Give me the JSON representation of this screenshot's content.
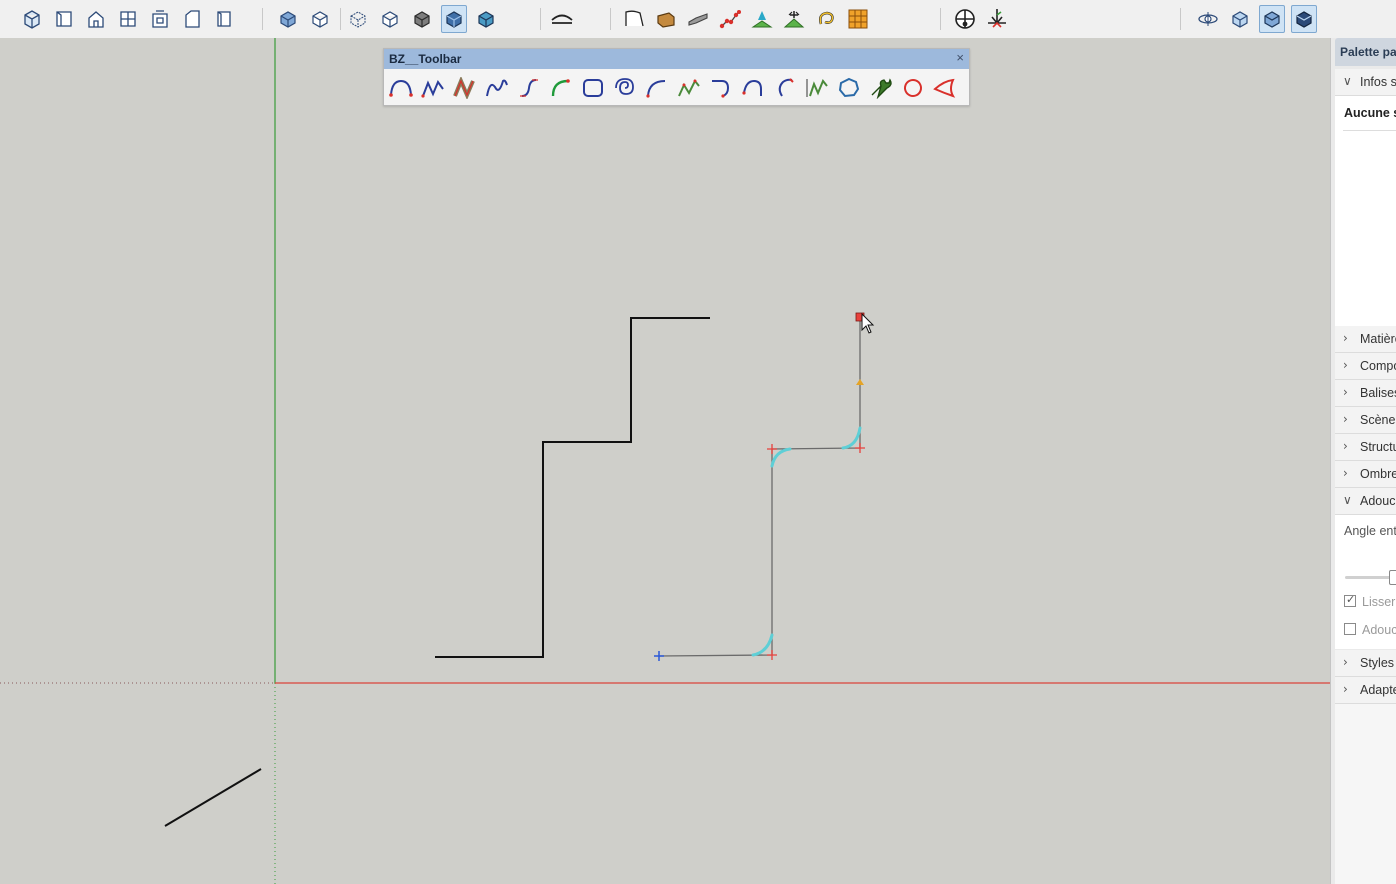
{
  "main_toolbar": {
    "icons": [
      "iso-view-icon",
      "top-view-icon",
      "front-view-icon",
      "right-view-icon",
      "back-view-icon",
      "left-view-icon",
      "bottom-view-icon",
      "xray-style-icon",
      "back-edges-style-icon",
      "wireframe-style-icon",
      "hidden-line-style-icon",
      "shaded-style-icon",
      "shaded-textures-style-icon",
      "monochrome-style-icon",
      "section-plane-icon",
      "sandbox-from-contours-icon",
      "sandbox-from-scratch-icon",
      "smoove-icon",
      "stamp-icon",
      "drape-icon",
      "add-detail-icon",
      "flip-edge-icon",
      "grid-icon",
      "axes-tool-icon",
      "dimension-tool-icon",
      "orbit-icon",
      "component-options-icon",
      "component-attributes-icon",
      "generate-report-icon"
    ]
  },
  "bz_toolbar": {
    "title": "BZ__Toolbar",
    "close_label": "×",
    "tools": [
      "bezier-classic-icon",
      "polyline-icon",
      "spline-icon",
      "b-spline-icon",
      "cubic-bezier-icon",
      "fillet-arc-icon",
      "rounded-rectangle-icon",
      "spiral-icon",
      "arc-icon",
      "uniform-bspline-icon",
      "catmull-spline-icon",
      "curve-continue-icon",
      "freehand-curve-icon",
      "polyline-divider-icon",
      "polygon-icon",
      "settings-wrench-icon",
      "ellipse-icon",
      "triangle-icon"
    ]
  },
  "panel": {
    "title": "Palette par défaut",
    "entity_info": {
      "label": "Infos sur l'entité",
      "value": "Aucune sélection"
    },
    "sections": [
      "Matières",
      "Composants",
      "Balises",
      "Scènes",
      "Structure",
      "Ombres"
    ],
    "smooth": {
      "label": "Adoucir les arêtes",
      "angle_label": "Angle entre les normales",
      "lisser_label": "Lisser les normales",
      "lisser_checked": true,
      "adoucir_label": "Adoucir les coplanaires",
      "adoucir_checked": false
    },
    "sections_after": [
      "Styles",
      "Adapter la photo"
    ]
  },
  "colors": {
    "x_axis": "#d9453a",
    "y_axis": "#3a9d3a",
    "edge": "#111111",
    "bezier_handle": "#5ecfd6",
    "control_point": "#e8413c",
    "start_point": "#2b59d8",
    "mid_marker": "#e5a426"
  }
}
